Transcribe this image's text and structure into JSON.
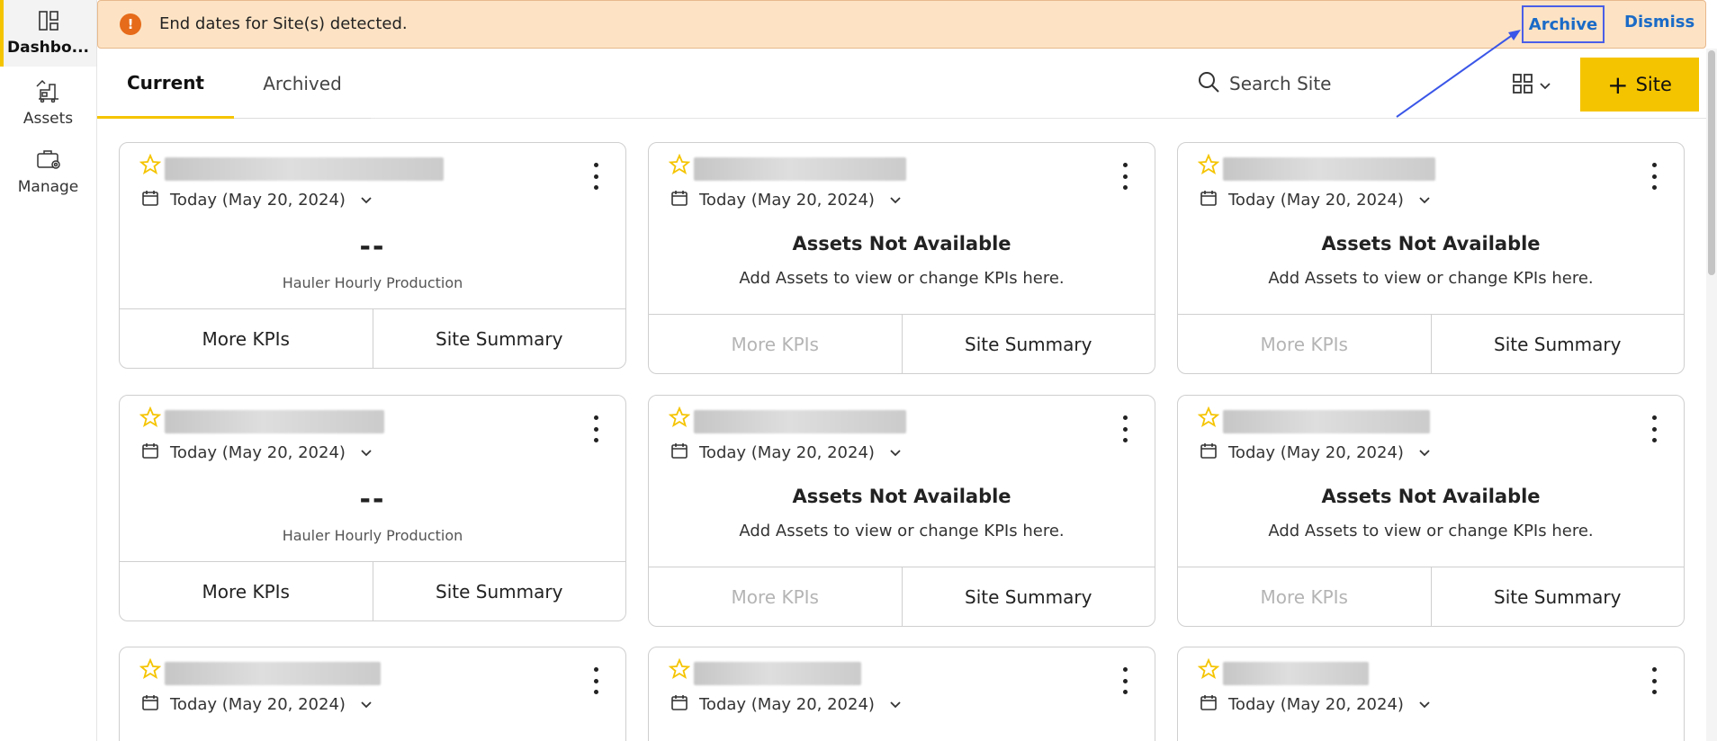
{
  "sidebar": {
    "items": [
      {
        "label": "Dashbo...",
        "icon": "dashboard-icon",
        "active": true
      },
      {
        "label": "Assets",
        "icon": "assets-icon",
        "active": false
      },
      {
        "label": "Manage",
        "icon": "manage-icon",
        "active": false
      }
    ]
  },
  "banner": {
    "icon": "warning-icon",
    "message": "End dates for Site(s) detected.",
    "archive_label": "Archive",
    "dismiss_label": "Dismiss",
    "color": "#fde3c4",
    "icon_color": "#e66b1a"
  },
  "tabs": [
    {
      "label": "Current",
      "active": true
    },
    {
      "label": "Archived",
      "active": false
    }
  ],
  "search": {
    "placeholder": "Search Site"
  },
  "add_site": {
    "label": "Site",
    "color": "#f5c400"
  },
  "cards": [
    {
      "date": "Today (May 20, 2024)",
      "kpi_value": "--",
      "kpi_label": "Hauler Hourly Production",
      "more_label": "More KPIs",
      "summary_label": "Site Summary"
    },
    {
      "date": "Today (May 20, 2024)",
      "na_title": "Assets Not Available",
      "na_sub": "Add Assets to view or change KPIs here.",
      "more_label": "More KPIs",
      "summary_label": "Site Summary"
    },
    {
      "date": "Today (May 20, 2024)",
      "na_title": "Assets Not Available",
      "na_sub": "Add Assets to view or change KPIs here.",
      "more_label": "More KPIs",
      "summary_label": "Site Summary"
    },
    {
      "date": "Today (May 20, 2024)",
      "kpi_value": "--",
      "kpi_label": "Hauler Hourly Production",
      "more_label": "More KPIs",
      "summary_label": "Site Summary"
    },
    {
      "date": "Today (May 20, 2024)",
      "na_title": "Assets Not Available",
      "na_sub": "Add Assets to view or change KPIs here.",
      "more_label": "More KPIs",
      "summary_label": "Site Summary"
    },
    {
      "date": "Today (May 20, 2024)",
      "na_title": "Assets Not Available",
      "na_sub": "Add Assets to view or change KPIs here.",
      "more_label": "More KPIs",
      "summary_label": "Site Summary"
    },
    {
      "date": "Today (May 20, 2024)"
    },
    {
      "date": "Today (May 20, 2024)"
    },
    {
      "date": "Today (May 20, 2024)"
    }
  ],
  "colors": {
    "accent": "#f5c400",
    "link": "#1b6bc7",
    "star": "#f5c400"
  }
}
